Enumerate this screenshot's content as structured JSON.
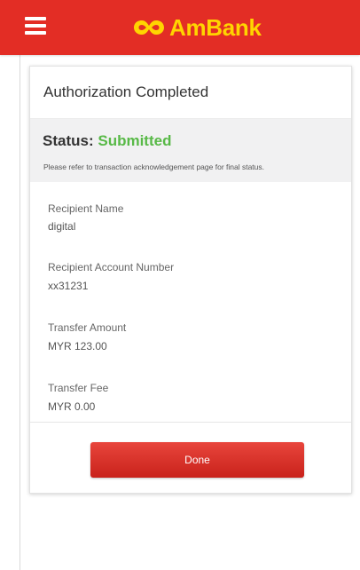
{
  "header": {
    "menu_icon": "hamburger-menu-icon",
    "logo_icon": "ambank-logo-icon",
    "logo_text": "AmBank",
    "background_color": "#e32d25",
    "logo_color": "#ffd400"
  },
  "card": {
    "title": "Authorization Completed",
    "status_label": "Status:",
    "status_value": "Submitted",
    "status_color": "#58b947",
    "status_note": "Please refer to transaction acknowledgement page for final status.",
    "fields": [
      {
        "label": "Recipient Name",
        "value": "digital"
      },
      {
        "label": "Recipient Account Number",
        "value": "xx31231"
      },
      {
        "label": "Transfer Amount",
        "value": "MYR 123.00"
      },
      {
        "label": "Transfer Fee",
        "value": "MYR 0.00"
      }
    ],
    "done_label": "Done"
  }
}
